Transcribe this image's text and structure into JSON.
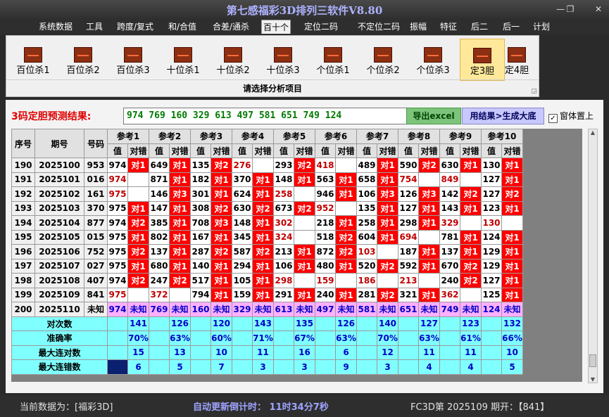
{
  "window": {
    "title": "第七感福彩3D排列三软件V8.80",
    "min": "—",
    "max": "❐",
    "close": "✕"
  },
  "menu": [
    "系统数据",
    "工具",
    "跨度/复式",
    "和/合值",
    "合差/通杀",
    "百十个",
    "定位二码",
    "不定位二码",
    "振幅",
    "特征",
    "后二",
    "后一",
    "计划"
  ],
  "menu_active": "百十个",
  "ribbon": {
    "buttons": [
      "百位杀1",
      "百位杀2",
      "百位杀3",
      "十位杀1",
      "十位杀2",
      "十位杀3",
      "个位杀1",
      "个位杀2",
      "个位杀3",
      "定3胆",
      "定4胆"
    ],
    "selected": "定3胆",
    "caption": "请选择分析项目",
    "launcher": "◲"
  },
  "prediction": {
    "label": "3码定胆预测结果:",
    "value": "974  769  160  329  613  497  581  651  749  124"
  },
  "buttons": {
    "excel": "导出excel",
    "generate": "用结果>生成大底"
  },
  "checkbox": {
    "label": "窗体置上",
    "checked": "✓"
  },
  "table": {
    "headers": {
      "seq": "序号",
      "period": "期号",
      "code": "号码",
      "refs": [
        "参考1",
        "参考2",
        "参考3",
        "参考4",
        "参考5",
        "参考6",
        "参考7",
        "参考8",
        "参考9",
        "参考10"
      ],
      "val": "值",
      "ok": "对错"
    },
    "rows": [
      {
        "seq": "190",
        "period": "2025100",
        "code": "953",
        "cells": [
          [
            "974",
            "",
            "对1"
          ],
          [
            "649",
            "",
            "对1"
          ],
          [
            "135",
            "",
            "对2"
          ],
          [
            "276",
            "r",
            ""
          ],
          [
            "293",
            "",
            "对2"
          ],
          [
            "418",
            "r",
            ""
          ],
          [
            "489",
            "",
            "对1"
          ],
          [
            "590",
            "",
            "对2"
          ],
          [
            "630",
            "",
            "对1"
          ],
          [
            "130",
            "",
            "对1"
          ]
        ]
      },
      {
        "seq": "191",
        "period": "2025101",
        "code": "016",
        "cells": [
          [
            "974",
            "r",
            ""
          ],
          [
            "871",
            "",
            "对1"
          ],
          [
            "182",
            "",
            "对1"
          ],
          [
            "370",
            "",
            "对1"
          ],
          [
            "148",
            "",
            "对1"
          ],
          [
            "563",
            "",
            "对1"
          ],
          [
            "658",
            "",
            "对1"
          ],
          [
            "754",
            "r",
            ""
          ],
          [
            "849",
            "r",
            ""
          ],
          [
            "127",
            "",
            "对1"
          ]
        ]
      },
      {
        "seq": "192",
        "period": "2025102",
        "code": "161",
        "cells": [
          [
            "975",
            "r",
            ""
          ],
          [
            "146",
            "",
            "对3"
          ],
          [
            "301",
            "",
            "对1"
          ],
          [
            "624",
            "",
            "对1"
          ],
          [
            "258",
            "r",
            ""
          ],
          [
            "946",
            "",
            "对1"
          ],
          [
            "106",
            "",
            "对3"
          ],
          [
            "126",
            "",
            "对3"
          ],
          [
            "142",
            "",
            "对2"
          ],
          [
            "127",
            "",
            "对2"
          ]
        ]
      },
      {
        "seq": "193",
        "period": "2025103",
        "code": "370",
        "cells": [
          [
            "975",
            "",
            "对1"
          ],
          [
            "147",
            "",
            "对1"
          ],
          [
            "308",
            "",
            "对2"
          ],
          [
            "630",
            "",
            "对2"
          ],
          [
            "673",
            "",
            "对2"
          ],
          [
            "952",
            "r",
            ""
          ],
          [
            "135",
            "",
            "对1"
          ],
          [
            "127",
            "",
            "对1"
          ],
          [
            "143",
            "",
            "对1"
          ],
          [
            "123",
            "",
            "对1"
          ]
        ]
      },
      {
        "seq": "194",
        "period": "2025104",
        "code": "877",
        "cells": [
          [
            "974",
            "",
            "对2"
          ],
          [
            "385",
            "",
            "对1"
          ],
          [
            "708",
            "",
            "对3"
          ],
          [
            "148",
            "",
            "对1"
          ],
          [
            "302",
            "r",
            ""
          ],
          [
            "218",
            "",
            "对1"
          ],
          [
            "258",
            "",
            "对1"
          ],
          [
            "298",
            "",
            "对1"
          ],
          [
            "329",
            "r",
            ""
          ],
          [
            "130",
            "r",
            ""
          ]
        ]
      },
      {
        "seq": "195",
        "period": "2025105",
        "code": "015",
        "cells": [
          [
            "975",
            "",
            "对1"
          ],
          [
            "802",
            "",
            "对1"
          ],
          [
            "167",
            "",
            "对1"
          ],
          [
            "345",
            "",
            "对1"
          ],
          [
            "324",
            "r",
            ""
          ],
          [
            "518",
            "",
            "对2"
          ],
          [
            "604",
            "",
            "对1"
          ],
          [
            "694",
            "r",
            ""
          ],
          [
            "781",
            "",
            "对1"
          ],
          [
            "124",
            "",
            "对1"
          ]
        ]
      },
      {
        "seq": "196",
        "period": "2025106",
        "code": "752",
        "cells": [
          [
            "975",
            "",
            "对2"
          ],
          [
            "137",
            "",
            "对1"
          ],
          [
            "287",
            "",
            "对2"
          ],
          [
            "587",
            "",
            "对2"
          ],
          [
            "213",
            "",
            "对1"
          ],
          [
            "872",
            "",
            "对2"
          ],
          [
            "103",
            "r",
            ""
          ],
          [
            "187",
            "",
            "对1"
          ],
          [
            "137",
            "",
            "对1"
          ],
          [
            "129",
            "",
            "对1"
          ]
        ]
      },
      {
        "seq": "197",
        "period": "2025107",
        "code": "027",
        "cells": [
          [
            "975",
            "",
            "对1"
          ],
          [
            "680",
            "",
            "对1"
          ],
          [
            "140",
            "",
            "对1"
          ],
          [
            "294",
            "",
            "对1"
          ],
          [
            "106",
            "",
            "对1"
          ],
          [
            "480",
            "",
            "对1"
          ],
          [
            "520",
            "",
            "对2"
          ],
          [
            "592",
            "",
            "对1"
          ],
          [
            "670",
            "",
            "对2"
          ],
          [
            "129",
            "",
            "对1"
          ]
        ]
      },
      {
        "seq": "198",
        "period": "2025108",
        "code": "407",
        "cells": [
          [
            "974",
            "",
            "对2"
          ],
          [
            "247",
            "",
            "对2"
          ],
          [
            "517",
            "",
            "对1"
          ],
          [
            "105",
            "",
            "对1"
          ],
          [
            "298",
            "r",
            ""
          ],
          [
            "159",
            "r",
            ""
          ],
          [
            "186",
            "r",
            ""
          ],
          [
            "213",
            "r",
            ""
          ],
          [
            "240",
            "",
            "对2"
          ],
          [
            "127",
            "",
            "对1"
          ]
        ]
      },
      {
        "seq": "199",
        "period": "2025109",
        "code": "841",
        "cells": [
          [
            "975",
            "r",
            ""
          ],
          [
            "372",
            "r",
            ""
          ],
          [
            "794",
            "",
            "对1"
          ],
          [
            "159",
            "",
            "对1"
          ],
          [
            "291",
            "",
            "对1"
          ],
          [
            "240",
            "",
            "对1"
          ],
          [
            "281",
            "",
            "对2"
          ],
          [
            "321",
            "",
            "对1"
          ],
          [
            "362",
            "r",
            ""
          ],
          [
            "125",
            "",
            "对1"
          ]
        ]
      }
    ],
    "pending": {
      "seq": "200",
      "period": "2025110",
      "code": "未知",
      "values": [
        "974",
        "769",
        "160",
        "329",
        "613",
        "497",
        "581",
        "651",
        "749",
        "124"
      ],
      "unknown": "未知"
    },
    "summary": [
      {
        "label": "对次数",
        "values": [
          "141",
          "126",
          "120",
          "143",
          "135",
          "126",
          "140",
          "127",
          "123",
          "132"
        ]
      },
      {
        "label": "准确率",
        "values": [
          "70%",
          "63%",
          "60%",
          "71%",
          "67%",
          "63%",
          "70%",
          "63%",
          "61%",
          "66%"
        ]
      },
      {
        "label": "最大连对数",
        "values": [
          "15",
          "13",
          "10",
          "11",
          "16",
          "6",
          "12",
          "11",
          "11",
          "10"
        ]
      },
      {
        "label": "最大连错数",
        "values": [
          "6",
          "5",
          "7",
          "3",
          "3",
          "9",
          "3",
          "4",
          "4",
          "5"
        ]
      }
    ]
  },
  "status": {
    "current": "当前数据为：[福彩3D]",
    "countdown": "自动更新倒计时：  11时34分7秒",
    "issue": "FC3D第 2025109 期开：【841】"
  },
  "colors": {
    "hit": "#ff0000",
    "pending_row": "#ffb0ff",
    "summary": "#80ffff",
    "selected_ribbon": "#ffe89a"
  }
}
